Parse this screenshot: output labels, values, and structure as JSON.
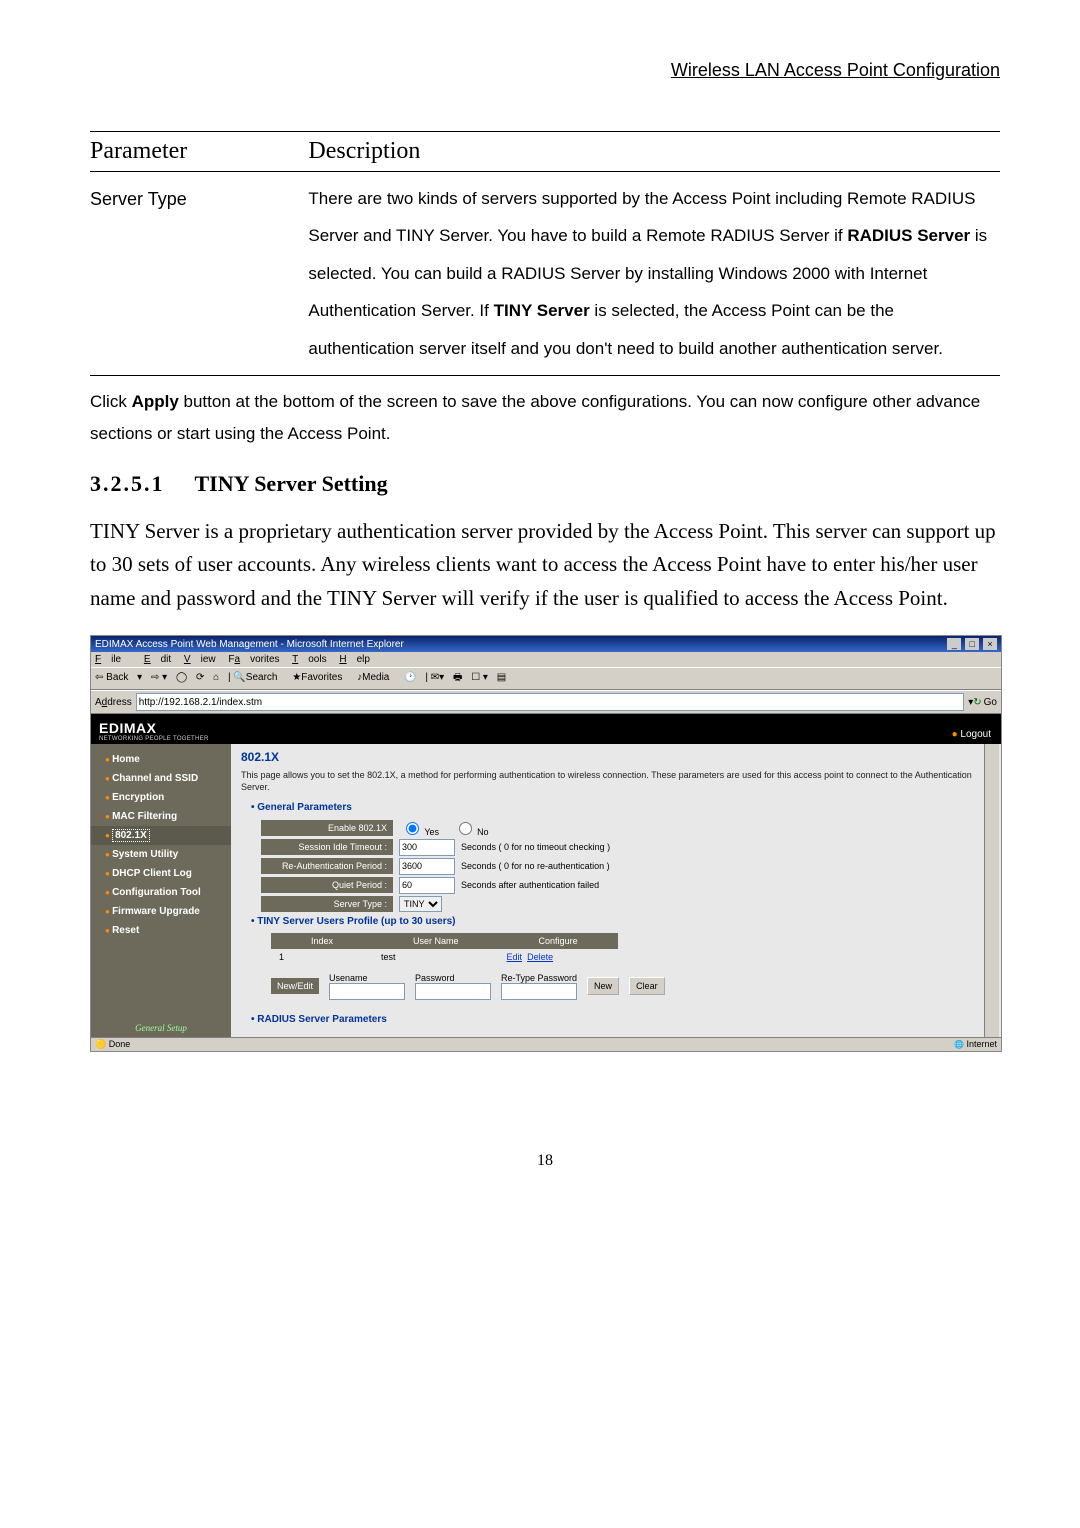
{
  "page_header": "Wireless LAN Access Point Configuration",
  "param_table": {
    "head_param": "Parameter",
    "head_desc": "Description",
    "row_param": "Server Type",
    "row_desc_full": "There are two kinds of servers supported by the Access Point including Remote RADIUS Server and TINY Server. You have to build a Remote RADIUS Server if RADIUS Server is selected. You can build a RADIUS Server by installing Windows 2000 with Internet Authentication Server. If TINY Server is selected, the Access Point can be the authentication server itself and you don't need to build another authentication server.",
    "d1": "There are two kinds of servers supported by the Access Point including Remote RADIUS Server and TINY Server. You have to build a Remote RADIUS Server if ",
    "d2": "RADIUS Server",
    "d3": " is selected. You can build a RADIUS Server by installing Windows 2000 with Internet Authentication Server. If ",
    "d4": "TINY Server",
    "d5": " is selected, the Access Point can be the authentication server itself and you don't need to build another authentication server."
  },
  "after_table_1": "Click ",
  "after_table_bold": "Apply",
  "after_table_2": " button at the bottom of the screen to save the above configurations. You can now configure other advance sections or start using the Access Point.",
  "section_num": "3.2.5.1",
  "section_title": "TINY Server Setting",
  "body_para": "TINY Server is a proprietary authentication server provided by the Access Point. This server can support up to 30 sets of user accounts. Any wireless clients want to access the Access Point have to enter his/her user name and password and the TINY Server will verify if the user is qualified to access the Access Point.",
  "ie": {
    "title": "EDIMAX Access Point Web Management - Microsoft Internet Explorer",
    "menu": {
      "file": "File",
      "edit": "Edit",
      "view": "View",
      "fav": "Favorites",
      "tools": "Tools",
      "help": "Help"
    },
    "toolbar": {
      "back": "Back",
      "search": "Search",
      "favorites": "Favorites",
      "media": "Media"
    },
    "address_label": "Address",
    "address_url": "http://192.168.2.1/index.stm",
    "go": "Go",
    "status_done": "Done",
    "status_net": "Internet"
  },
  "edimax": {
    "logo": "EDIMAX",
    "tag": "NETWORKING PEOPLE TOGETHER",
    "logout": "Logout"
  },
  "sidebar": {
    "items": [
      {
        "label": "Home",
        "name": "sidebar-item-home"
      },
      {
        "label": "Channel and SSID",
        "name": "sidebar-item-channel"
      },
      {
        "label": "Encryption",
        "name": "sidebar-item-encryption"
      },
      {
        "label": "MAC Filtering",
        "name": "sidebar-item-mac"
      },
      {
        "label": "802.1X",
        "name": "sidebar-item-8021x",
        "active": true
      },
      {
        "label": "System Utility",
        "name": "sidebar-item-system"
      },
      {
        "label": "DHCP Client Log",
        "name": "sidebar-item-dhcp"
      },
      {
        "label": "Configuration Tool",
        "name": "sidebar-item-config"
      },
      {
        "label": "Firmware Upgrade",
        "name": "sidebar-item-firmware"
      },
      {
        "label": "Reset",
        "name": "sidebar-item-reset"
      }
    ],
    "general_setup": "General Setup"
  },
  "main": {
    "title": "802.1X",
    "desc": "This page allows you to set the 802.1X, a method for performing authentication to wireless connection. These parameters are used for this access point to connect to the Authentication Server.",
    "gp_head": "General Parameters",
    "rows": {
      "enable_lbl": "Enable 802.1X",
      "yes": "Yes",
      "no": "No",
      "idle_lbl": "Session Idle Timeout :",
      "idle_val": "300",
      "idle_after": "Seconds ( 0 for no timeout checking )",
      "reauth_lbl": "Re-Authentication Period :",
      "reauth_val": "3600",
      "reauth_after": "Seconds ( 0 for no re-authentication )",
      "quiet_lbl": "Quiet Period :",
      "quiet_val": "60",
      "quiet_after": "Seconds after authentication failed",
      "stype_lbl": "Server Type :",
      "stype_val": "TINY"
    },
    "tiny_head": "TINY Server Users Profile (up to 30 users)",
    "tbl": {
      "h_index": "Index",
      "h_user": "User Name",
      "h_conf": "Configure",
      "idx": "1",
      "user": "test",
      "edit": "Edit",
      "del": "Delete"
    },
    "ne": {
      "lbl": "New/Edit",
      "uname": "Usename",
      "pass": "Password",
      "repass": "Re-Type Password",
      "new": "New",
      "clear": "Clear"
    },
    "radius_head": "RADIUS Server Parameters"
  },
  "page_number": "18"
}
